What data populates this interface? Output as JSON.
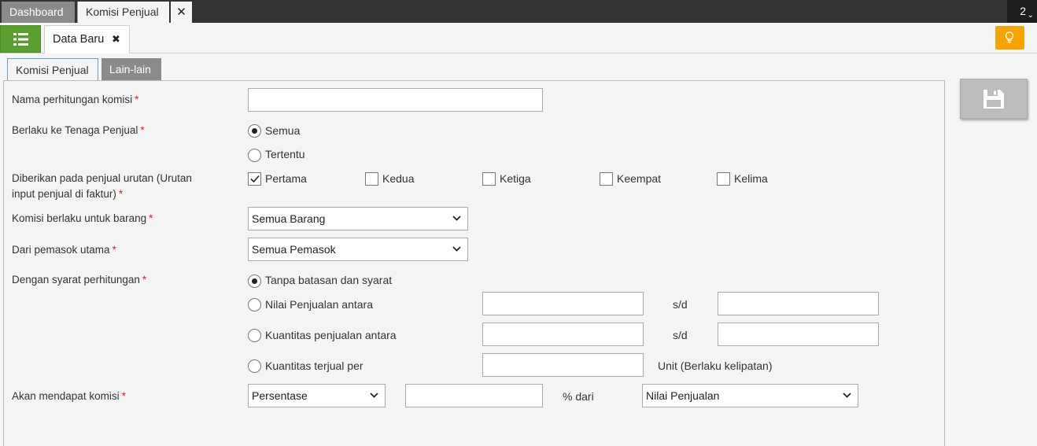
{
  "top_tabs": {
    "dashboard": "Dashboard",
    "komisi": "Komisi Penjual",
    "close": "✕",
    "count": "2"
  },
  "second_bar": {
    "tab_label": "Data Baru",
    "tab_close": "✖"
  },
  "inner_tabs": [
    "Komisi Penjual",
    "Lain-lain"
  ],
  "form": {
    "nama_label": "Nama perhitungan komisi",
    "nama_value": "",
    "berlaku_label": "Berlaku ke Tenaga Penjual",
    "berlaku_options": [
      "Semua",
      "Tertentu"
    ],
    "berlaku_selected": "Semua",
    "urutan_label_line1": "Diberikan pada penjual urutan (Urutan",
    "urutan_label_line2": "input penjual di faktur)",
    "urutan_options": [
      {
        "label": "Pertama",
        "checked": true
      },
      {
        "label": "Kedua",
        "checked": false
      },
      {
        "label": "Ketiga",
        "checked": false
      },
      {
        "label": "Keempat",
        "checked": false
      },
      {
        "label": "Kelima",
        "checked": false
      }
    ],
    "barang_label": "Komisi berlaku untuk barang",
    "barang_value": "Semua Barang",
    "pemasok_label": "Dari pemasok utama",
    "pemasok_value": "Semua Pemasok",
    "syarat_label": "Dengan syarat perhitungan",
    "syarat_options": [
      "Tanpa batasan dan syarat",
      "Nilai Penjualan antara",
      "Kuantitas penjualan antara",
      "Kuantitas terjual per"
    ],
    "syarat_selected": "Tanpa batasan dan syarat",
    "sd": "s/d",
    "unit_note": "Unit (Berlaku kelipatan)",
    "komisi_label": "Akan mendapat komisi",
    "komisi_type": "Persentase",
    "komisi_value": "",
    "persen_dari": "% dari",
    "dari_value": "Nilai Penjualan",
    "required_mark": "*"
  },
  "colors": {
    "menu_green": "#5a9e2f",
    "bulb_orange": "#f7a400",
    "topbar": "#333333"
  },
  "icons": [
    "list-menu-icon",
    "lightbulb-icon",
    "save-disk-icon",
    "close-icon",
    "chevron-down-icon"
  ]
}
